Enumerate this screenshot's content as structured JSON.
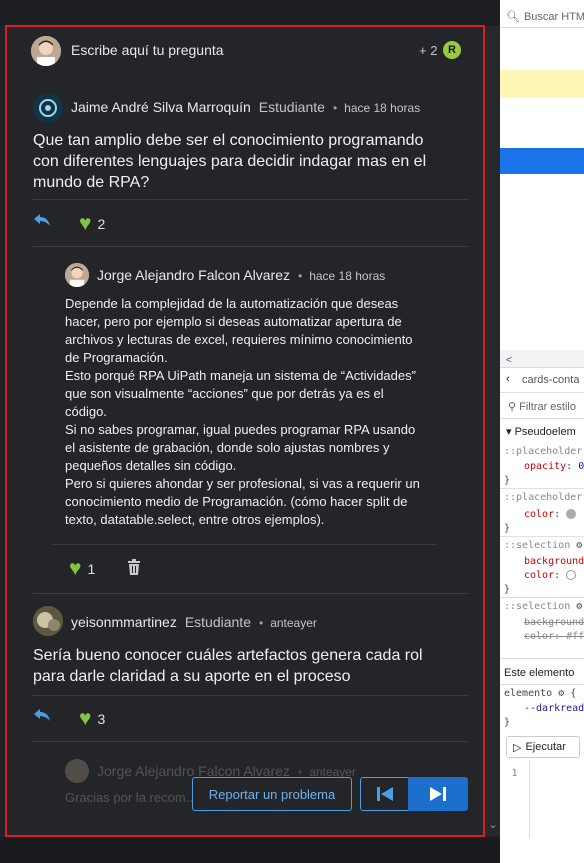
{
  "ask": {
    "placeholder": "Escribe aquí tu pregunta",
    "count": "+ 2",
    "badge": "R"
  },
  "question1": {
    "author": "Jaime André Silva Marroquín",
    "role": "Estudiante",
    "time": "hace 18 horas",
    "text": "Que tan amplio debe ser el conocimiento programando con diferentes lenguajes para decidir indagar mas en el mundo de RPA?",
    "likes": "2"
  },
  "reply1": {
    "author": "Jorge Alejandro Falcon Alvarez",
    "time": "hace 18 horas",
    "paragraphs": [
      "Depende la complejidad de la automatización que deseas hacer, pero por ejemplo si deseas automatizar apertura de archivos y lecturas de excel, requieres mínimo conocimiento de Programación.",
      "Esto porqué RPA UiPath maneja un sistema de “Actividades” que son visualmente “acciones” que por detrás ya es el código.",
      "Si no sabes programar, igual puedes programar RPA usando el asistente de grabación, donde solo ajustas nombres y pequeños detalles sin código.",
      "Pero si quieres ahondar y ser profesional, si vas a requerir un conocimiento medio de Programación. (cómo hacer split de texto, datatable.select, entre otros ejemplos)."
    ],
    "likes": "1"
  },
  "question2": {
    "author": "yeisonmmartinez",
    "role": "Estudiante",
    "time": "anteayer",
    "text": "Sería bueno conocer cuáles artefactos genera cada rol para darle claridad a su aporte en el proceso",
    "likes": "3"
  },
  "faded_reply": {
    "author": "Jorge Alejandro Falcon Alvarez",
    "time": "anteayer",
    "text": "Gracias por la recom... esta clase."
  },
  "footer": {
    "report_label": "Reportar un problema"
  },
  "devtools": {
    "search_placeholder": "Buscar HTM",
    "breadcrumb": "cards-conta",
    "filter_placeholder": "Filtrar estilo",
    "pseudo_header": "Pseudoelem",
    "rule1_selector": "::placeholder",
    "rule1_prop": "opacity",
    "rule1_val": "0",
    "rule2_selector": "::placeholder",
    "rule2_prop": "color",
    "rule3_selector": "::selection",
    "rule3_prop1": "background",
    "rule3_prop2": "color",
    "rule4_selector": "::selection",
    "rule4_prop1": "background",
    "rule4_prop2": "color: #ff",
    "element_header": "Este elemento",
    "element_selector": "elemento",
    "element_var": "--darkread",
    "run_label": "Ejecutar",
    "line_number": "1",
    "brace_open": "{",
    "brace_close": "}",
    "colon": ":"
  }
}
